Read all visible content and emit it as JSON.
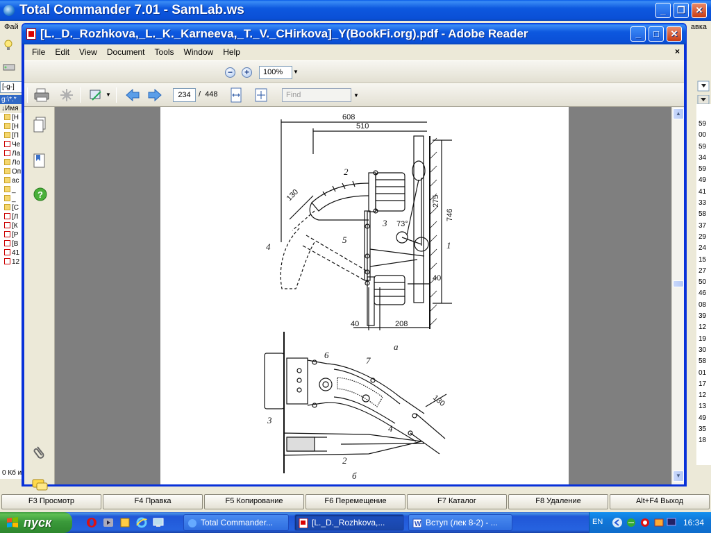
{
  "total_commander": {
    "title": "Total Commander 7.01 - SamLab.ws",
    "menu_left": "Фай",
    "menu_right": "авка",
    "drive_left": "[-g-]",
    "path_left": "g:\\*.*",
    "column_name": "↓Имя",
    "status_left": "0 Кб и",
    "left_rows": [
      "[Н",
      "[Н",
      "[П",
      "Че",
      "Ла",
      "Ло",
      "Оп",
      "ас",
      "_",
      "_",
      "[С",
      "[Л",
      "[К",
      "[Р",
      "[В",
      "41",
      "12"
    ],
    "right_numbers": [
      "59",
      "00",
      "59",
      "34",
      "59",
      "49",
      "41",
      "33",
      "58",
      "37",
      "29",
      "24",
      "15",
      "27",
      "50",
      "46",
      "08",
      "39",
      "12",
      "19",
      "30",
      "58",
      "01",
      "17",
      "12",
      "13",
      "49",
      "35",
      "18"
    ],
    "fkeys": [
      "F3 Просмотр",
      "F4 Правка",
      "F5 Копирование",
      "F6 Перемещение",
      "F7 Каталог",
      "F8 Удаление",
      "Alt+F4 Выход"
    ]
  },
  "reader": {
    "title": "[L._D._Rozhkova,_L._K._Karneeva,_T._V._CHirkova]_Y(BookFi.org).pdf - Adobe Reader",
    "menu": [
      "File",
      "Edit",
      "View",
      "Document",
      "Tools",
      "Window",
      "Help"
    ],
    "doc_close": "×",
    "zoom": "100%",
    "page_current": "234",
    "page_separator": "/",
    "page_total": "448",
    "find_placeholder": "Find"
  },
  "drawing": {
    "dims": [
      "608",
      "510",
      "130",
      "275",
      "746",
      "73°",
      "40",
      "40",
      "208",
      "130"
    ],
    "labels_a": [
      "2",
      "3",
      "1",
      "4",
      "5"
    ],
    "labels_b": [
      "6",
      "7",
      "3",
      "4",
      "2"
    ],
    "caption_a": "а",
    "caption_b": "б"
  },
  "taskbar": {
    "start": "пуск",
    "tasks": [
      "Total Commander...",
      "[L._D._Rozhkova,...",
      "Вступ (лек 8-2) - ..."
    ],
    "language": "EN",
    "clock": "16:34"
  },
  "colors": {
    "xp_blue": "#0a4fd6",
    "start_green": "#3b9a3b",
    "reader_gray": "#7f7f7f"
  }
}
